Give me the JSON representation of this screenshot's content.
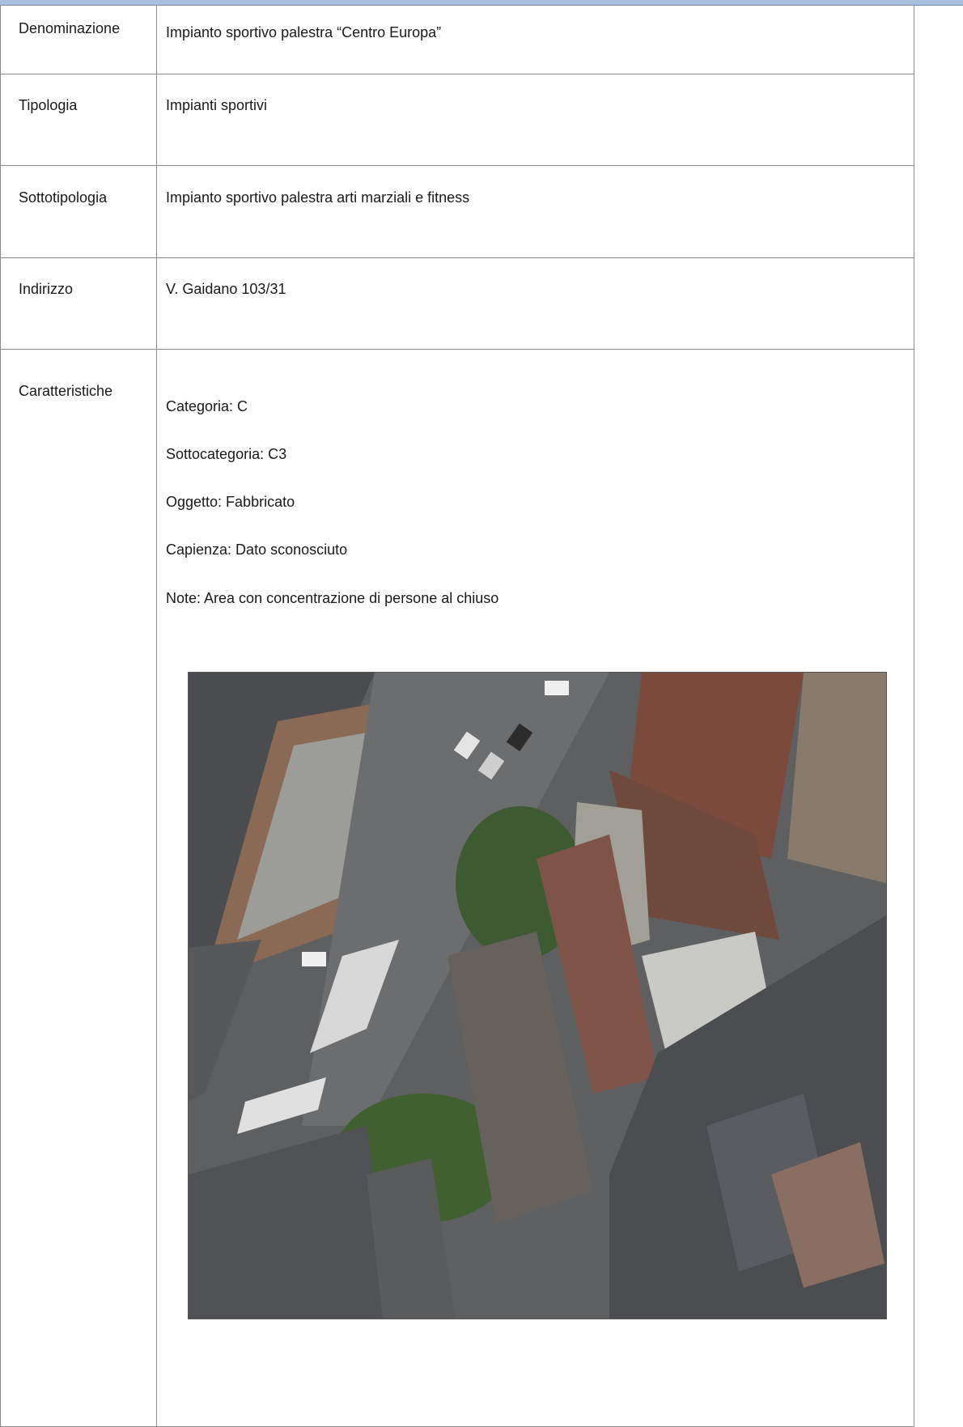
{
  "rows": [
    {
      "label": "Denominazione",
      "value": "Impianto sportivo palestra “Centro Europa”"
    },
    {
      "label": "Tipologia",
      "value": "Impianti sportivi"
    },
    {
      "label": "Sottotipologia",
      "value": "Impianto sportivo palestra arti marziali e fitness"
    },
    {
      "label": "Indirizzo",
      "value": "V. Gaidano 103/31"
    }
  ],
  "caratteristiche": {
    "label": "Caratteristiche",
    "categoria": "Categoria: C",
    "sottocategoria": "Sottocategoria: C3",
    "oggetto": "Oggetto: Fabbricato",
    "capienza": "Capienza: Dato sconosciuto",
    "note": "Note: Area con concentrazione di persone al chiuso"
  },
  "image": {
    "alt": "aerial-satellite-view",
    "colors": {
      "roof_dark": "#4a4c50",
      "roof_red": "#7a4a3c",
      "road": "#5e5f60",
      "trees": "#3e5a32"
    }
  }
}
